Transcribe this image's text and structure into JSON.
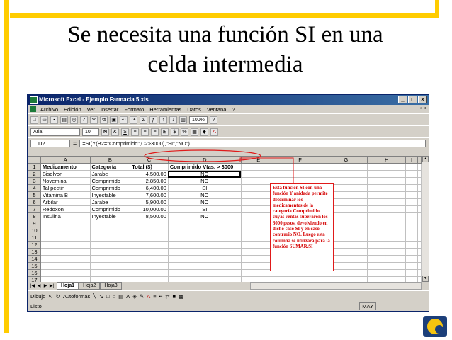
{
  "slide": {
    "title_line1": "Se necesita una función SI en una",
    "title_line2": "celda intermedia"
  },
  "excel": {
    "window_title": "Microsoft Excel - Ejemplo Farmacia 5.xls",
    "window_buttons": [
      "_",
      "□",
      "×"
    ],
    "menu": [
      "Archivo",
      "Edición",
      "Ver",
      "Insertar",
      "Formato",
      "Herramientas",
      "Datos",
      "Ventana",
      "?"
    ],
    "menu_right": "_ ▫ ×",
    "toolbar": {
      "zoom": "100%",
      "font_name": "Arial",
      "font_size": "10"
    },
    "formula_bar": {
      "cell_ref": "D2",
      "eq": "=",
      "formula": "=SI(Y(B2=\"Comprimido\",C2>3000),\"SI\",\"NO\")"
    },
    "columns": [
      "A",
      "B",
      "C",
      "D",
      "E",
      "F",
      "G",
      "H",
      "I"
    ],
    "header_row": [
      "Medicamento",
      "Categoría",
      "Total ($)",
      "Comprimido Vtas. > 3000"
    ],
    "rows": [
      [
        "Bisolvon",
        "Jarabe",
        "4,500.00",
        "NO"
      ],
      [
        "Novemina",
        "Comprimido",
        "2,850.00",
        "NO"
      ],
      [
        "Talipectin",
        "Comprimido",
        "6,400.00",
        "SI"
      ],
      [
        "Vitamina B",
        "Inyectable",
        "7,600.00",
        "NO"
      ],
      [
        "Arbilar",
        "Jarabe",
        "5,900.00",
        "NO"
      ],
      [
        "Redoxon",
        "Comprimido",
        "10,000.00",
        "SI"
      ],
      [
        "Insulina",
        "Inyectable",
        "8,500.00",
        "NO"
      ]
    ],
    "row_numbers": [
      "1",
      "2",
      "3",
      "4",
      "5",
      "6",
      "7",
      "8",
      "9",
      "10",
      "11",
      "12",
      "13",
      "14",
      "15",
      "16",
      "17"
    ],
    "sheet_tabs": [
      "Hoja1",
      "Hoja2",
      "Hoja3"
    ],
    "draw_toolbar": {
      "dibujo": "Dibujo",
      "autoformas": "Autoformas"
    },
    "status": {
      "left": "Listo",
      "right": "MAY"
    }
  },
  "callout": {
    "text": "Esta función SI con una función Y anidada permite determinar los medicamentos de la categoría Comprimido cuyas ventas superaron los 3000 pesos, devolviendo en dicho caso SI y en caso contrario NO. Luego esta columna se utilizará para la función SUMAR.SI"
  },
  "colors": {
    "accent_bar": "#ffcc00",
    "callout_red": "#e01a1a",
    "excel_titlebar": "#0a246a"
  }
}
